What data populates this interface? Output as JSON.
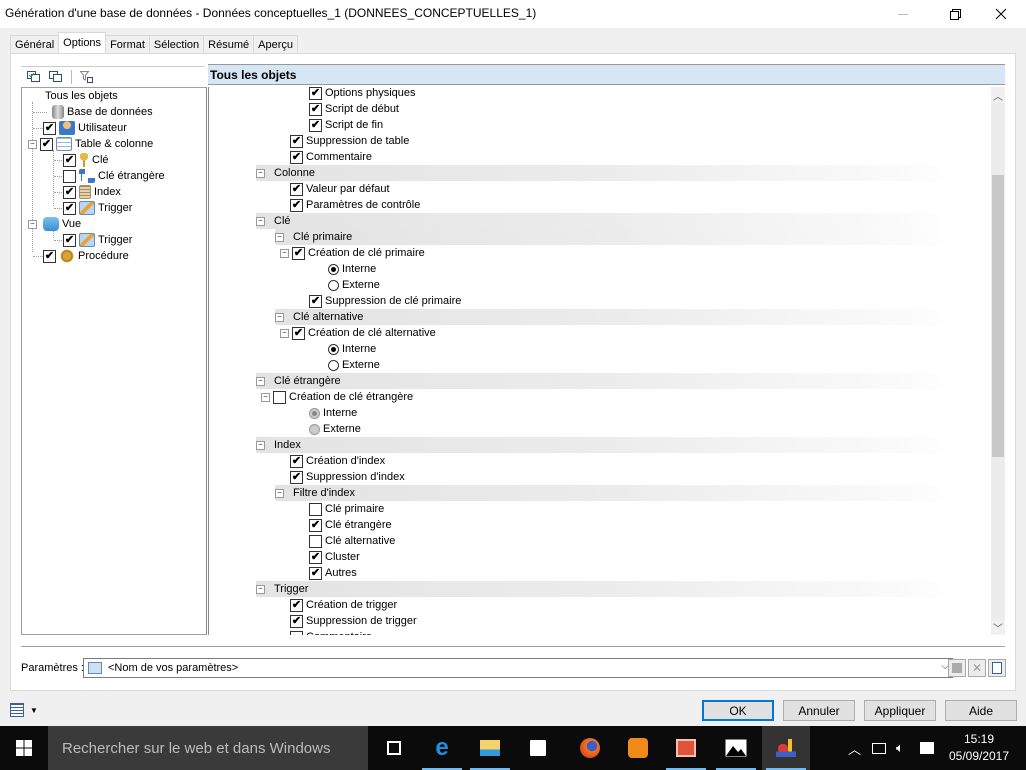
{
  "window": {
    "title": "Génération d'une base de données - Données conceptuelles_1 (DONNEES_CONCEPTUELLES_1)",
    "minimize_glyph": "—",
    "restore_glyph": "❐",
    "close_glyph": "✕"
  },
  "tabs": [
    {
      "label": "Général",
      "active": false
    },
    {
      "label": "Options",
      "active": true
    },
    {
      "label": "Format",
      "active": false
    },
    {
      "label": "Sélection",
      "active": false
    },
    {
      "label": "Résumé",
      "active": false
    },
    {
      "label": "Aperçu",
      "active": false
    }
  ],
  "left_tree": {
    "root": "Tous les objets",
    "items": [
      {
        "label": "Base de données",
        "checkbox": null,
        "icon": "database-icon"
      },
      {
        "label": "Utilisateur",
        "checkbox": true,
        "icon": "user-icon"
      },
      {
        "label": "Table & colonne",
        "checkbox": true,
        "icon": "table-icon",
        "expanded": true
      },
      {
        "label": "Clé",
        "checkbox": true,
        "icon": "key-icon"
      },
      {
        "label": "Clé étrangère",
        "checkbox": false,
        "icon": "foreign-key-icon"
      },
      {
        "label": "Index",
        "checkbox": true,
        "icon": "index-icon"
      },
      {
        "label": "Trigger",
        "checkbox": true,
        "icon": "trigger-icon"
      },
      {
        "label": "Vue",
        "checkbox": null,
        "icon": "view-icon",
        "expanded": true
      },
      {
        "label": "Trigger",
        "checkbox": true,
        "icon": "trigger-icon"
      },
      {
        "label": "Procédure",
        "checkbox": true,
        "icon": "procedure-icon"
      }
    ]
  },
  "right_panel": {
    "header": "Tous les objets",
    "options": [
      {
        "label": "Options physiques",
        "type": "checkbox",
        "checked": true
      },
      {
        "label": "Script de début",
        "type": "checkbox",
        "checked": true
      },
      {
        "label": "Script de fin",
        "type": "checkbox",
        "checked": true
      },
      {
        "label": "Suppression de table",
        "type": "checkbox",
        "checked": true
      },
      {
        "label": "Commentaire",
        "type": "checkbox",
        "checked": true
      },
      {
        "label": "Colonne",
        "type": "group"
      },
      {
        "label": "Valeur par défaut",
        "type": "checkbox",
        "checked": true
      },
      {
        "label": "Paramètres de contrôle",
        "type": "checkbox",
        "checked": true
      },
      {
        "label": "Clé",
        "type": "group"
      },
      {
        "label": "Clé primaire",
        "type": "group"
      },
      {
        "label": "Création de clé primaire",
        "type": "checkbox",
        "checked": true,
        "expander": true
      },
      {
        "label": "Interne",
        "type": "radio",
        "selected": true
      },
      {
        "label": "Externe",
        "type": "radio",
        "selected": false
      },
      {
        "label": "Suppression de clé primaire",
        "type": "checkbox",
        "checked": true
      },
      {
        "label": "Clé alternative",
        "type": "group"
      },
      {
        "label": "Création de clé alternative",
        "type": "checkbox",
        "checked": true,
        "expander": true
      },
      {
        "label": "Interne",
        "type": "radio",
        "selected": true
      },
      {
        "label": "Externe",
        "type": "radio",
        "selected": false
      },
      {
        "label": "Clé étrangère",
        "type": "group"
      },
      {
        "label": "Création de clé étrangère",
        "type": "checkbox",
        "checked": false,
        "expander": true
      },
      {
        "label": "Interne",
        "type": "radio",
        "selected": true,
        "disabled": true
      },
      {
        "label": "Externe",
        "type": "radio",
        "selected": false,
        "disabled": true
      },
      {
        "label": "Index",
        "type": "group"
      },
      {
        "label": "Création d'index",
        "type": "checkbox",
        "checked": true
      },
      {
        "label": "Suppression d'index",
        "type": "checkbox",
        "checked": true
      },
      {
        "label": "Filtre d'index",
        "type": "group"
      },
      {
        "label": "Clé primaire",
        "type": "checkbox",
        "checked": false
      },
      {
        "label": "Clé étrangère",
        "type": "checkbox",
        "checked": true
      },
      {
        "label": "Clé alternative",
        "type": "checkbox",
        "checked": false
      },
      {
        "label": "Cluster",
        "type": "checkbox",
        "checked": true
      },
      {
        "label": "Autres",
        "type": "checkbox",
        "checked": true
      },
      {
        "label": "Trigger",
        "type": "group"
      },
      {
        "label": "Création de trigger",
        "type": "checkbox",
        "checked": true
      },
      {
        "label": "Suppression de trigger",
        "type": "checkbox",
        "checked": true
      },
      {
        "label": "Commentaire",
        "type": "checkbox",
        "checked": false
      }
    ],
    "scroll_position": 0.3
  },
  "parameters": {
    "label": "Paramètres :",
    "value": "<Nom de vos paramètres>"
  },
  "buttons": {
    "ok": "OK",
    "cancel": "Annuler",
    "apply": "Appliquer",
    "help": "Aide"
  },
  "taskbar": {
    "search_placeholder": "Rechercher sur le web et dans Windows",
    "time": "15:19",
    "date": "05/09/2017",
    "apps": [
      "task-view",
      "edge",
      "file-explorer",
      "store",
      "firefox",
      "uc-browser",
      "powerpoint",
      "photos",
      "powerdesigner"
    ]
  }
}
